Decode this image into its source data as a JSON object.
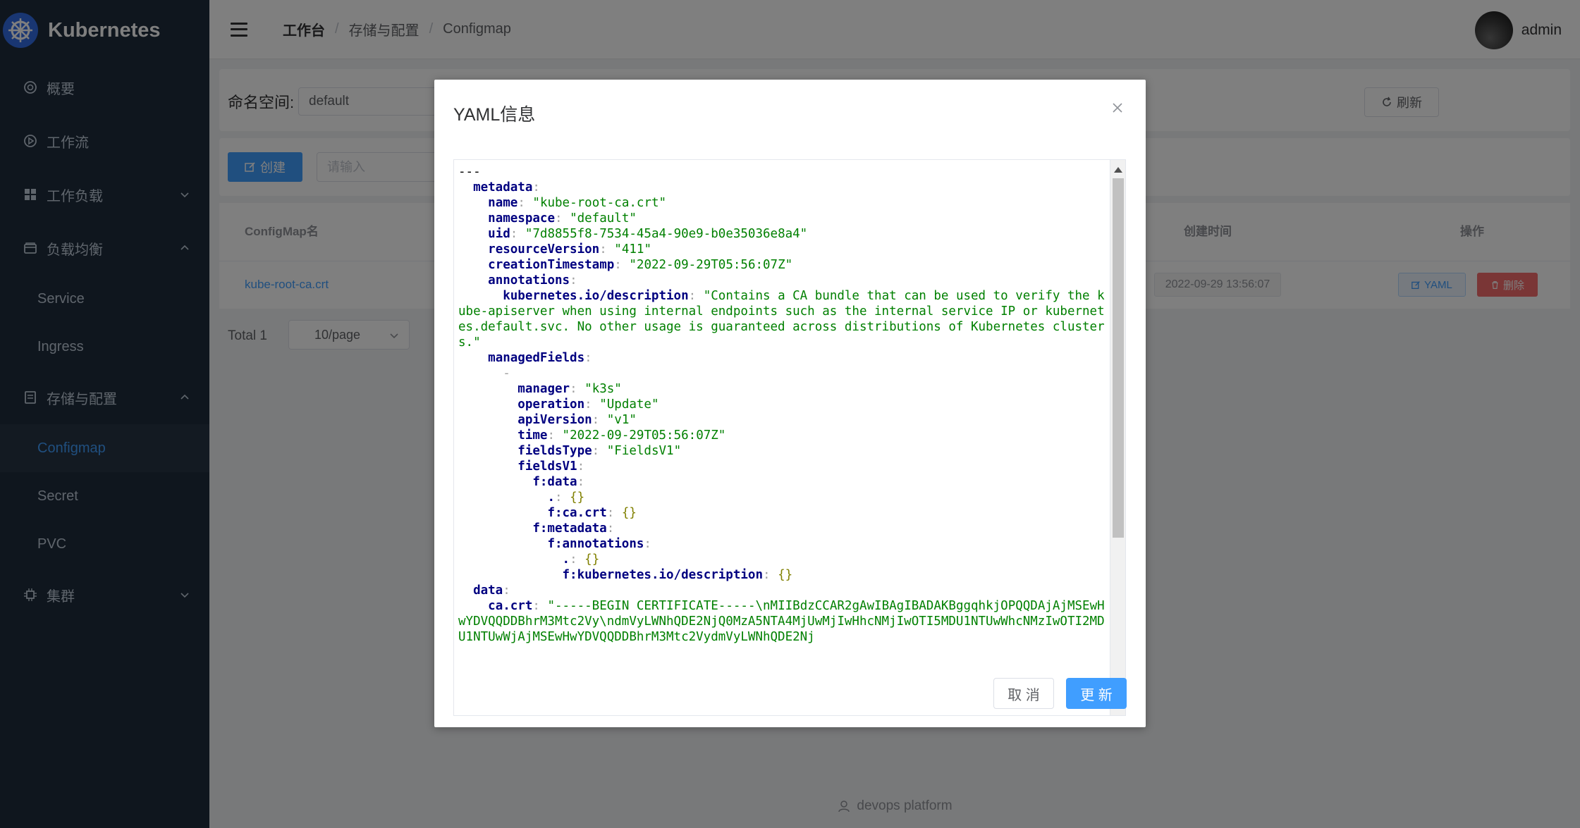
{
  "app": {
    "title": "Kubernetes"
  },
  "sidebar": {
    "items": [
      {
        "label": "概要",
        "icon": "gauge-icon"
      },
      {
        "label": "工作流",
        "icon": "play-circle-icon"
      },
      {
        "label": "工作负载",
        "icon": "grid-icon",
        "expandable": true
      },
      {
        "label": "负载均衡",
        "icon": "wallet-icon",
        "expandable": true,
        "expanded": true,
        "children": [
          {
            "label": "Service"
          },
          {
            "label": "Ingress"
          }
        ]
      },
      {
        "label": "存储与配置",
        "icon": "document-icon",
        "expandable": true,
        "expanded": true,
        "children": [
          {
            "label": "Configmap",
            "active": true
          },
          {
            "label": "Secret"
          },
          {
            "label": "PVC"
          }
        ]
      },
      {
        "label": "集群",
        "icon": "cpu-icon",
        "expandable": true
      }
    ]
  },
  "header": {
    "breadcrumb": [
      "工作台",
      "存储与配置",
      "Configmap"
    ],
    "username": "admin"
  },
  "filters": {
    "namespace_label": "命名空间:",
    "namespace_value": "default",
    "refresh_label": "刷新",
    "create_label": "创建",
    "search_placeholder": "请输入"
  },
  "table": {
    "columns": [
      "ConfigMap名",
      "创建时间",
      "操作"
    ],
    "rows": [
      {
        "name": "kube-root-ca.crt",
        "created": "2022-09-29 13:56:07",
        "yaml_label": "YAML",
        "delete_label": "删除"
      }
    ]
  },
  "pagination": {
    "total": "Total 1",
    "page_size": "10/page"
  },
  "footer": {
    "text": "devops platform"
  },
  "modal": {
    "title": "YAML信息",
    "cancel_label": "取 消",
    "update_label": "更 新",
    "yaml": {
      "doc_start": "---",
      "name": "\"kube-root-ca.crt\"",
      "namespace": "\"default\"",
      "uid": "\"7d8855f8-7534-45a4-90e9-b0e35036e8a4\"",
      "resourceVersion": "\"411\"",
      "creationTimestamp": "\"2022-09-29T05:56:07Z\"",
      "description": "\"Contains a CA bundle that can be used to verify the kube-apiserver when using internal endpoints such as the internal service IP or kubernetes.default.svc. No other usage is guaranteed across distributions of Kubernetes clusters.\"",
      "manager": "\"k3s\"",
      "operation": "\"Update\"",
      "apiVersion": "\"v1\"",
      "time": "\"2022-09-29T05:56:07Z\"",
      "fieldsType": "\"FieldsV1\"",
      "ca_crt": "\"-----BEGIN CERTIFICATE-----\\nMIIBdzCCAR2gAwIBAgIBADAKBggqhkjOPQQDAjAjMSEwHwYDVQQDDBhrM3Mtc2Vy\\ndmVyLWNhQDE2NjQ0MzA5NTA4MjUwMjIwHhcNMjIwOTI5MDU1NTUwWhcNMzIwOTI2MDU1NTUwWjAjMSEwHwYDVQQDDBhrM3Mtc2VydmVyLWNhQDE2Nj"
    }
  }
}
